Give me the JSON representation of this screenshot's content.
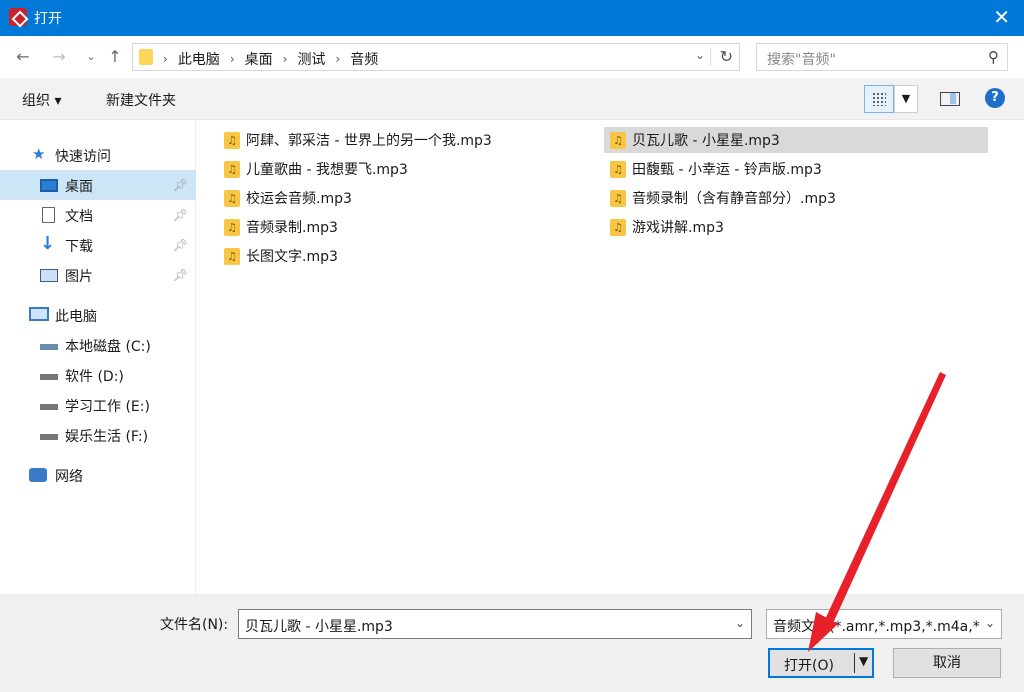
{
  "window": {
    "title": "打开",
    "close_icon": "close-icon"
  },
  "nav": {
    "breadcrumbs": [
      "此电脑",
      "桌面",
      "测试",
      "音频"
    ],
    "search_placeholder": "搜索\"音频\""
  },
  "toolbar": {
    "organize": "组织 ▾",
    "new_folder": "新建文件夹",
    "help": "?"
  },
  "sidebar": {
    "quick_access": "快速访问",
    "quick_items": [
      "桌面",
      "文档",
      "下载",
      "图片"
    ],
    "this_pc": "此电脑",
    "drives": [
      "本地磁盘 (C:)",
      "软件 (D:)",
      "学习工作 (E:)",
      "娱乐生活 (F:)"
    ],
    "network": "网络"
  },
  "files": {
    "col1": [
      "阿肆、郭采洁 - 世界上的另一个我.mp3",
      "儿童歌曲 - 我想要飞.mp3",
      "校运会音频.mp3",
      "音频录制.mp3",
      "长图文字.mp3"
    ],
    "col2": [
      "贝瓦儿歌 - 小星星.mp3",
      "田馥甄 - 小幸运 - 铃声版.mp3",
      "音频录制（含有静音部分）.mp3",
      "游戏讲解.mp3"
    ],
    "selected": "贝瓦儿歌 - 小星星.mp3"
  },
  "bottom": {
    "filename_label": "文件名(N):",
    "filename_value": "贝瓦儿歌 - 小星星.mp3",
    "filetype_value": "音频文件(*.amr,*.mp3,*.m4a,*",
    "open_label": "打开(O)",
    "cancel_label": "取消"
  },
  "colors": {
    "titlebar": "#0078d7",
    "selection": "#cde6f7",
    "annotation_arrow": "#e8202a"
  }
}
